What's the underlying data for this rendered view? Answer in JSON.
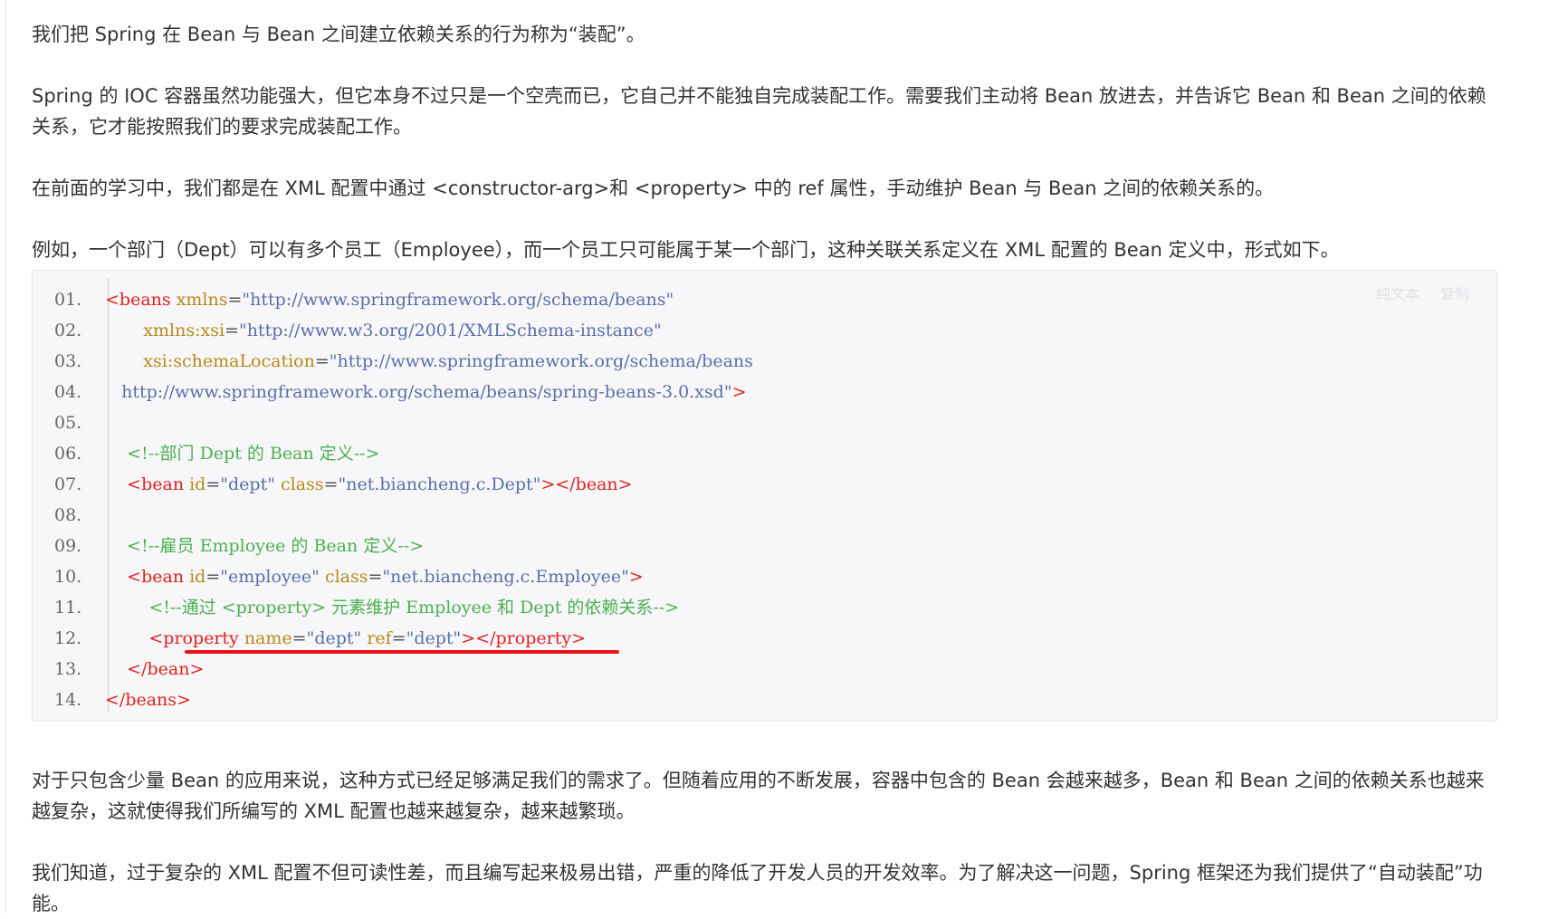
{
  "paragraphs": {
    "p1": "我们把 Spring 在 Bean 与 Bean 之间建立依赖关系的行为称为“装配”。",
    "p2": "Spring 的 IOC 容器虽然功能强大，但它本身不过只是一个空壳而已，它自己并不能独自完成装配工作。需要我们主动将 Bean 放进去，并告诉它 Bean 和 Bean 之间的依赖关系，它才能按照我们的要求完成装配工作。",
    "p3": "在前面的学习中，我们都是在 XML 配置中通过 <constructor-arg>和 <property> 中的 ref 属性，手动维护 Bean 与 Bean 之间的依赖关系的。",
    "p4": "例如，一个部门（Dept）可以有多个员工（Employee），而一个员工只可能属于某一个部门，这种关联关系定义在 XML 配置的 Bean 定义中，形式如下。",
    "p5": "对于只包含少量 Bean 的应用来说，这种方式已经足够满足我们的需求了。但随着应用的不断发展，容器中包含的 Bean 会越来越多，Bean 和 Bean 之间的依赖关系也越来越复杂，这就使得我们所编写的 XML 配置也越来越复杂，越来越繁琐。",
    "p6": "我们知道，过于复杂的 XML 配置不但可读性差，而且编写起来极易出错，严重的降低了开发人员的开发效率。为了解决这一问题，Spring 框架还为我们提供了“自动装配”功能。"
  },
  "code_tools": {
    "plain_text": "纯文本",
    "copy": "复制"
  },
  "code_lines": [
    {
      "n": "01.",
      "segs": [
        [
          "t",
          "<beans "
        ],
        [
          "a",
          "xmlns"
        ],
        [
          "p",
          "="
        ],
        [
          "v",
          "\"http://www.springframework.org/schema/beans\""
        ]
      ]
    },
    {
      "n": "02.",
      "segs": [
        [
          "p",
          "       "
        ],
        [
          "a",
          "xmlns:xsi"
        ],
        [
          "p",
          "="
        ],
        [
          "v",
          "\"http://www.w3.org/2001/XMLSchema-instance\""
        ]
      ]
    },
    {
      "n": "03.",
      "segs": [
        [
          "p",
          "       "
        ],
        [
          "a",
          "xsi:schemaLocation"
        ],
        [
          "p",
          "="
        ],
        [
          "v",
          "\"http://www.springframework.org/schema/beans"
        ]
      ]
    },
    {
      "n": "04.",
      "segs": [
        [
          "v",
          "   http://www.springframework.org/schema/beans/spring-beans-3.0.xsd\""
        ],
        [
          "t",
          ">"
        ]
      ]
    },
    {
      "n": "05.",
      "segs": []
    },
    {
      "n": "06.",
      "segs": [
        [
          "cm",
          "    <!--部门 Dept 的 Bean 定义-->"
        ]
      ]
    },
    {
      "n": "07.",
      "segs": [
        [
          "t",
          "    <bean "
        ],
        [
          "a",
          "id"
        ],
        [
          "p",
          "="
        ],
        [
          "v",
          "\"dept\""
        ],
        [
          "p",
          " "
        ],
        [
          "a",
          "class"
        ],
        [
          "p",
          "="
        ],
        [
          "v",
          "\"net.biancheng.c.Dept\""
        ],
        [
          "t",
          "></bean>"
        ]
      ]
    },
    {
      "n": "08.",
      "segs": []
    },
    {
      "n": "09.",
      "segs": [
        [
          "cm",
          "    <!--雇员 Employee 的 Bean 定义-->"
        ]
      ]
    },
    {
      "n": "10.",
      "segs": [
        [
          "t",
          "    <bean "
        ],
        [
          "a",
          "id"
        ],
        [
          "p",
          "="
        ],
        [
          "v",
          "\"employee\""
        ],
        [
          "p",
          " "
        ],
        [
          "a",
          "class"
        ],
        [
          "p",
          "="
        ],
        [
          "v",
          "\"net.biancheng.c.Employee\""
        ],
        [
          "t",
          ">"
        ]
      ]
    },
    {
      "n": "11.",
      "segs": [
        [
          "cm",
          "        <!--通过 <property> 元素维护 Employee 和 Dept 的依赖关系-->"
        ]
      ]
    },
    {
      "n": "12.",
      "segs": [
        [
          "t",
          "        <property "
        ],
        [
          "a",
          "name"
        ],
        [
          "p",
          "="
        ],
        [
          "v",
          "\"dept\""
        ],
        [
          "p",
          " "
        ],
        [
          "a",
          "ref"
        ],
        [
          "p",
          "="
        ],
        [
          "v",
          "\"dept\""
        ],
        [
          "t",
          "></property>"
        ]
      ]
    },
    {
      "n": "13.",
      "segs": [
        [
          "t",
          "    </bean>"
        ]
      ]
    },
    {
      "n": "14.",
      "segs": [
        [
          "t",
          "</beans>"
        ]
      ]
    }
  ]
}
